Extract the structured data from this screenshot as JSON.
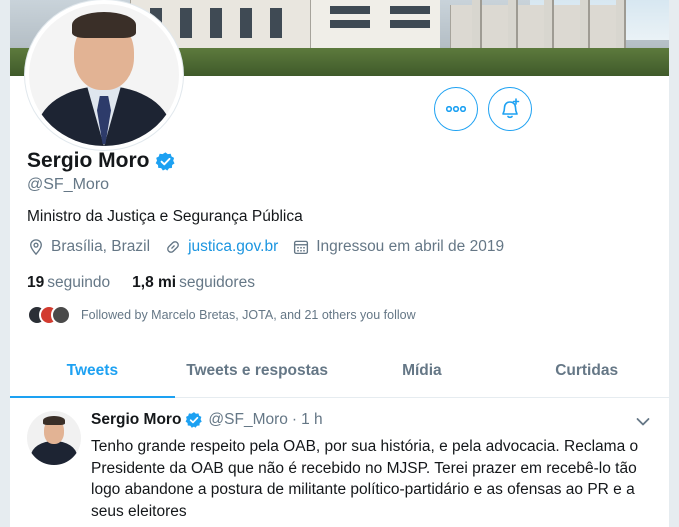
{
  "profile": {
    "name": "Sergio Moro",
    "handle": "@SF_Moro",
    "bio": "Ministro da Justiça e Segurança Pública",
    "location": "Brasília, Brazil",
    "website": "justica.gov.br",
    "joined": "Ingressou em abril de 2019",
    "following_count": "19",
    "following_label": "seguindo",
    "followers_count": "1,8 mi",
    "followers_label": "seguidores",
    "followed_by": "Followed by Marcelo Bretas, JOTA, and 21 others you follow"
  },
  "actions": {
    "more_icon": "more-dots-icon",
    "notify_icon": "bell-plus-icon"
  },
  "tabs": [
    {
      "label": "Tweets",
      "active": true
    },
    {
      "label": "Tweets e respostas",
      "active": false
    },
    {
      "label": "Mídia",
      "active": false
    },
    {
      "label": "Curtidas",
      "active": false
    }
  ],
  "tweet": {
    "name": "Sergio Moro",
    "handle": "@SF_Moro",
    "separator": "·",
    "time": "1 h",
    "text": "Tenho grande respeito pela OAB, por sua história, e pela advocacia. Reclama o Presidente da OAB que não é recebido no MJSP. Terei prazer em recebê-lo tão logo abandone a postura de militante político-partidário e as ofensas ao PR e a seus eleitores"
  },
  "colors": {
    "accent": "#1da1f2",
    "link": "#1b95e0",
    "secondary_text": "#657786",
    "primary_text": "#14171a"
  }
}
